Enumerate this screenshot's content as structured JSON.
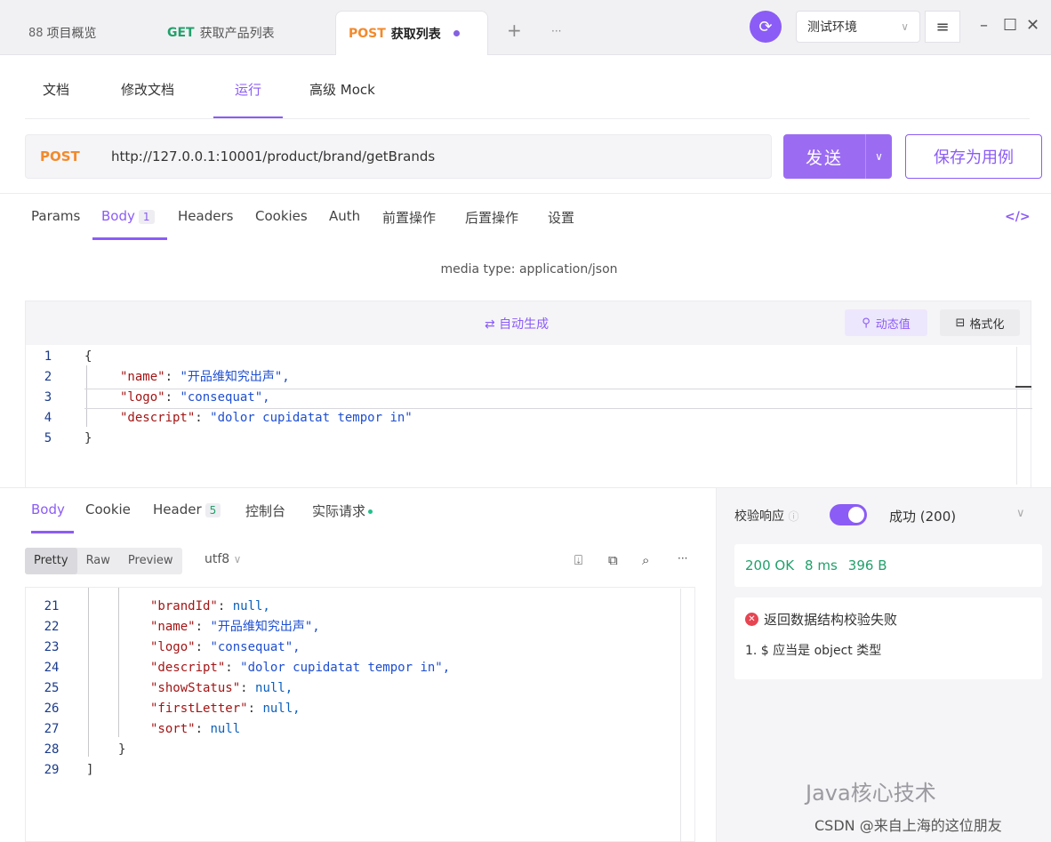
{
  "tabs": [
    {
      "icon": "88",
      "method": "",
      "label": "项目概览"
    },
    {
      "icon": "",
      "method": "GET",
      "label": "获取产品列表"
    },
    {
      "icon": "",
      "method": "POST",
      "label": "获取列表"
    }
  ],
  "tab_add": "+",
  "tab_more": "···",
  "env": {
    "selected": "测试环境"
  },
  "subnav": [
    "文档",
    "修改文档",
    "运行",
    "高级 Mock"
  ],
  "request": {
    "method": "POST",
    "url": "http://127.0.0.1:10001/product/brand/getBrands",
    "send_label": "发送",
    "save_label": "保存为用例"
  },
  "req_tabs": {
    "params": "Params",
    "body": "Body",
    "body_count": "1",
    "headers": "Headers",
    "cookies": "Cookies",
    "auth": "Auth",
    "pre": "前置操作",
    "post": "后置操作",
    "settings": "设置"
  },
  "media_type": "media type: application/json",
  "editor": {
    "autogen": "⇄ 自动生成",
    "dynamic": "动态值",
    "format": "格式化",
    "lines": [
      {
        "n": "1",
        "t": "{"
      },
      {
        "n": "2",
        "k": "\"name\"",
        "v": "\"开品维知究出声\","
      },
      {
        "n": "3",
        "k": "\"logo\"",
        "v": "\"consequat\","
      },
      {
        "n": "4",
        "k": "\"descript\"",
        "v": "\"dolor cupidatat tempor in\""
      },
      {
        "n": "5",
        "t": "}"
      }
    ]
  },
  "resp_tabs": {
    "body": "Body",
    "cookie": "Cookie",
    "header": "Header",
    "header_count": "5",
    "console": "控制台",
    "actual": "实际请求"
  },
  "view": {
    "pretty": "Pretty",
    "raw": "Raw",
    "preview": "Preview",
    "encoding": "utf8"
  },
  "response_lines": [
    {
      "n": "21",
      "k": "\"brandId\"",
      "v": "null,"
    },
    {
      "n": "22",
      "k": "\"name\"",
      "v": "\"开品维知究出声\","
    },
    {
      "n": "23",
      "k": "\"logo\"",
      "v": "\"consequat\","
    },
    {
      "n": "24",
      "k": "\"descript\"",
      "v": "\"dolor cupidatat tempor in\","
    },
    {
      "n": "25",
      "k": "\"showStatus\"",
      "v": "null,"
    },
    {
      "n": "26",
      "k": "\"firstLetter\"",
      "v": "null,"
    },
    {
      "n": "27",
      "k": "\"sort\"",
      "v": "null"
    },
    {
      "n": "28",
      "t": "}"
    },
    {
      "n": "29",
      "t": "]"
    }
  ],
  "validation": {
    "label": "校验响应",
    "result": "成功 (200)",
    "status": "200 OK",
    "time": "8 ms",
    "size": "396 B",
    "error_title": "返回数据结构校验失败",
    "error_item": "1. $ 应当是 object 类型"
  },
  "watermark": {
    "line1": "Java核心技术",
    "line2": "CSDN @来自上海的这位朋友"
  }
}
